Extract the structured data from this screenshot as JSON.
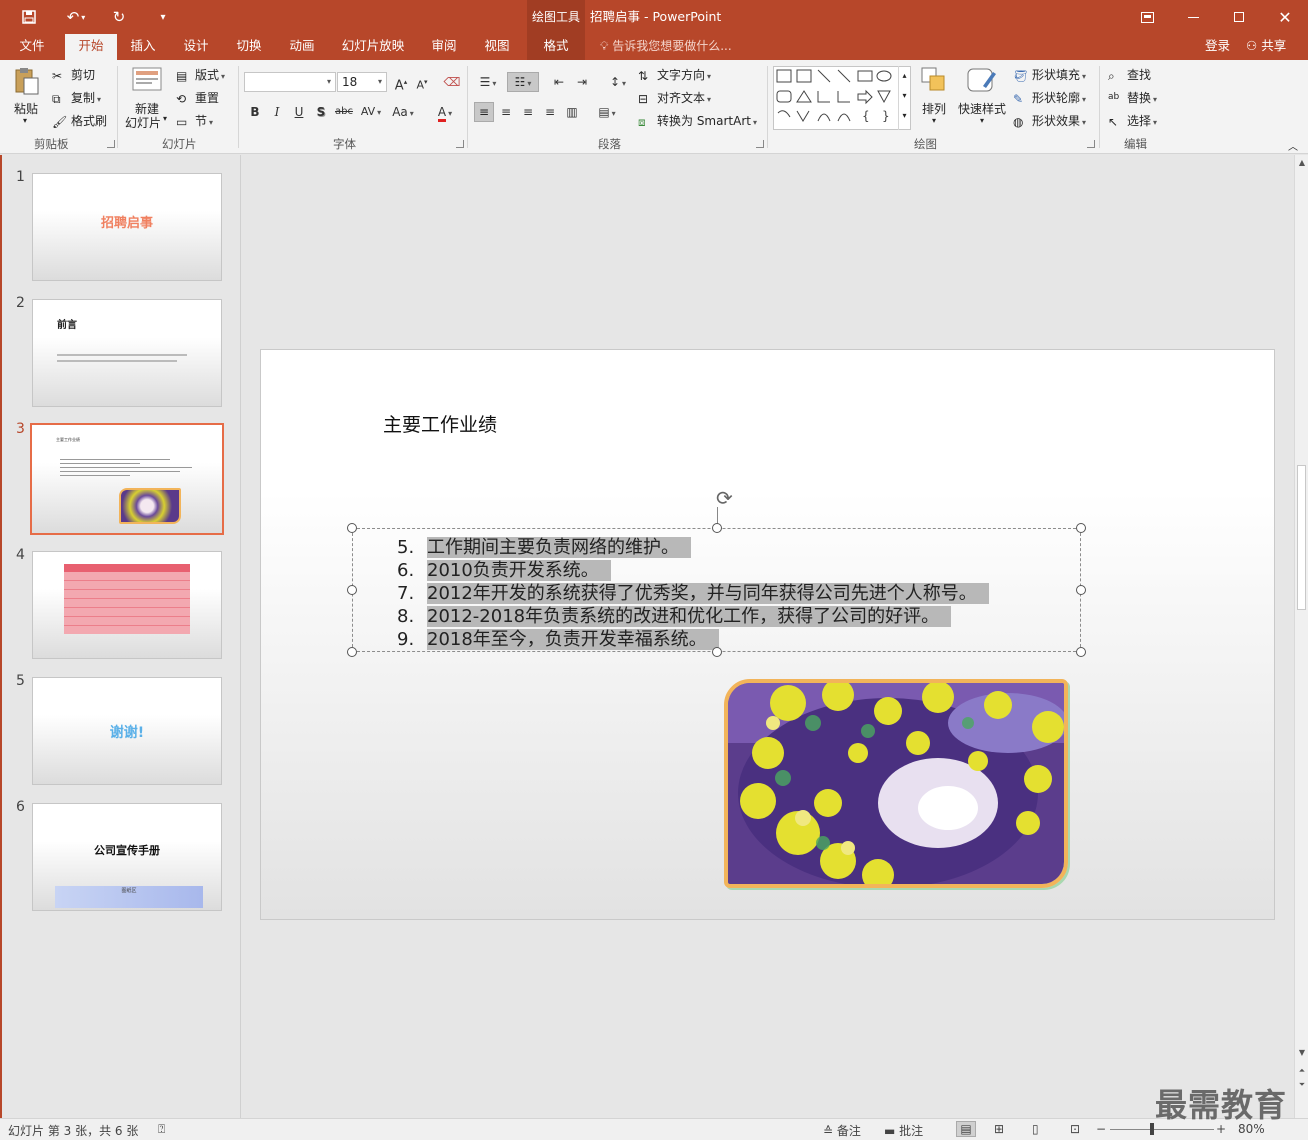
{
  "titlebar": {
    "context_tab": "绘图工具",
    "title": "招聘启事 - PowerPoint"
  },
  "tabs": [
    {
      "label": "文件"
    },
    {
      "label": "开始"
    },
    {
      "label": "插入"
    },
    {
      "label": "设计"
    },
    {
      "label": "切换"
    },
    {
      "label": "动画"
    },
    {
      "label": "幻灯片放映"
    },
    {
      "label": "审阅"
    },
    {
      "label": "视图"
    },
    {
      "label": "格式"
    }
  ],
  "search_placeholder": "告诉我您想要做什么...",
  "login": "登录",
  "share": "共享",
  "ribbon": {
    "clipboard": {
      "paste": "粘贴",
      "cut": "剪切",
      "copy": "复制",
      "format_painter": "格式刷",
      "label": "剪贴板"
    },
    "slides": {
      "new_slide_1": "新建",
      "new_slide_2": "幻灯片",
      "layout": "版式",
      "reset": "重置",
      "section": "节",
      "label": "幻灯片"
    },
    "font": {
      "size": "18",
      "label": "字体"
    },
    "paragraph": {
      "text_direction": "文字方向",
      "align_text": "对齐文本",
      "smartart": "转换为 SmartArt",
      "label": "段落"
    },
    "drawing": {
      "arrange": "排列",
      "quick_styles": "快速样式",
      "fill": "形状填充",
      "outline": "形状轮廓",
      "effects": "形状效果",
      "label": "绘图"
    },
    "editing": {
      "find": "查找",
      "replace": "替换",
      "select": "选择",
      "label": "编辑"
    }
  },
  "thumbnails": [
    {
      "num": "1",
      "title": "招聘启事"
    },
    {
      "num": "2",
      "title": "前言"
    },
    {
      "num": "3",
      "title": "主要工作业绩"
    },
    {
      "num": "4",
      "title": ""
    },
    {
      "num": "5",
      "title": "谢谢!"
    },
    {
      "num": "6",
      "title": "公司宣传手册",
      "footer": "图纸区"
    }
  ],
  "slide": {
    "title": "主要工作业绩",
    "items": [
      {
        "num": "5.",
        "text": "工作期间主要负责网络的维护。"
      },
      {
        "num": "6.",
        "text": "2010负责开发系统。"
      },
      {
        "num": "7.",
        "text": "2012年开发的系统获得了优秀奖，并与同年获得公司先进个人称号。"
      },
      {
        "num": "8.",
        "text": "2012-2018年负责系统的改进和优化工作，获得了公司的好评。"
      },
      {
        "num": "9.",
        "text": "2018年至今，负责开发幸福系统。"
      }
    ]
  },
  "status": {
    "slide_info": "幻灯片 第 3 张，共 6 张",
    "notes": "备注",
    "comments": "批注",
    "zoom": "80%"
  },
  "watermark": "最需教育",
  "colors": {
    "accent": "#b7472a",
    "active_thumb": "#e66c47"
  }
}
